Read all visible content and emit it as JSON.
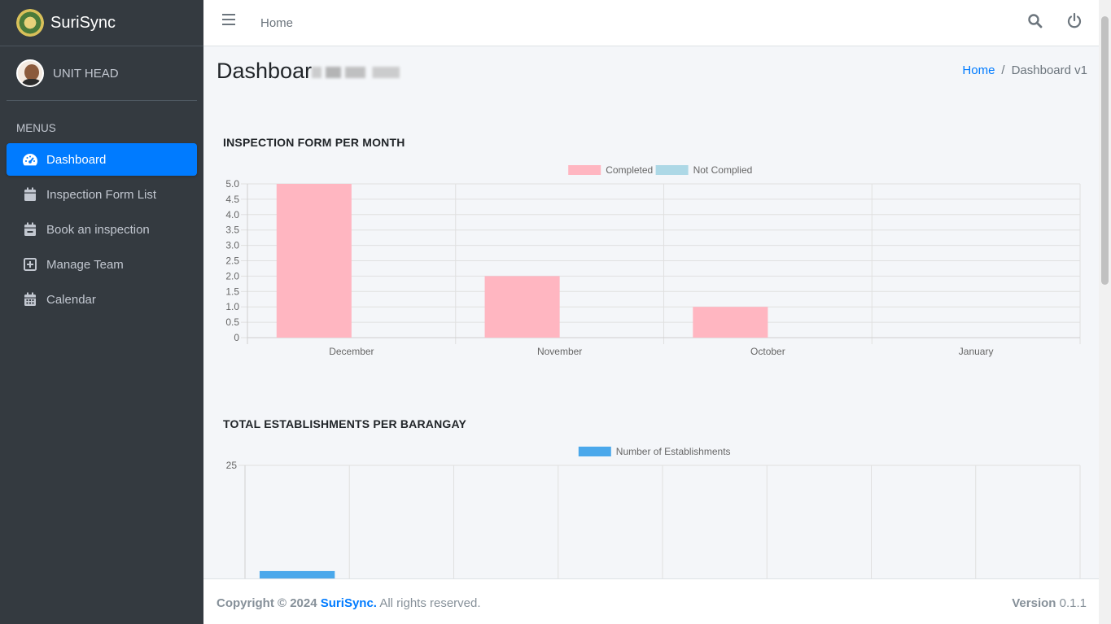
{
  "brand": {
    "name_bold": "Suri",
    "name_light": "Sync"
  },
  "user": {
    "role": "UNIT HEAD"
  },
  "sidebar": {
    "header": "MENUS",
    "items": [
      {
        "label": "Dashboard",
        "icon": "tachometer-icon",
        "active": true
      },
      {
        "label": "Inspection Form List",
        "icon": "calendar-icon"
      },
      {
        "label": "Book an inspection",
        "icon": "calendar-minus-icon"
      },
      {
        "label": "Manage Team",
        "icon": "plus-square-icon"
      },
      {
        "label": "Calendar",
        "icon": "calendar-grid-icon"
      }
    ]
  },
  "topbar": {
    "home_label": "Home"
  },
  "page": {
    "title": "Dashboar"
  },
  "breadcrumb": {
    "home": "Home",
    "separator": "/",
    "current": "Dashboard v1"
  },
  "colors": {
    "accent": "#007bff",
    "sidebar_bg": "#343a40",
    "completed": "#ffb6c1",
    "not_complied": "#add8e6",
    "establishments": "#4aa8eb"
  },
  "charts_titles": {
    "inspection": "INSPECTION FORM PER MONTH",
    "establishments": "TOTAL ESTABLISHMENTS PER BARANGAY"
  },
  "chart_data": [
    {
      "type": "bar",
      "title": "INSPECTION FORM PER MONTH",
      "categories": [
        "December",
        "November",
        "October",
        "January"
      ],
      "series": [
        {
          "name": "Completed",
          "values": [
            5,
            2,
            1,
            0
          ],
          "color": "#ffb6c1"
        },
        {
          "name": "Not Complied",
          "values": [
            0,
            0,
            0,
            0
          ],
          "color": "#add8e6"
        }
      ],
      "ylim": [
        0,
        5
      ],
      "yticks": [
        "5.0",
        "4.5",
        "4.0",
        "3.5",
        "3.0",
        "2.5",
        "2.0",
        "1.5",
        "1.0",
        "0.5",
        "0"
      ],
      "legend": "top-center",
      "grid": true
    },
    {
      "type": "bar",
      "title": "TOTAL ESTABLISHMENTS PER BARANGAY",
      "categories": [
        "",
        "",
        "",
        "",
        "",
        "",
        "",
        ""
      ],
      "series": [
        {
          "name": "Number of Establishments",
          "values": [
            11,
            null,
            null,
            null,
            null,
            null,
            null,
            null
          ],
          "color": "#4aa8eb"
        }
      ],
      "ylim": [
        0,
        25
      ],
      "yticks": [
        "25"
      ],
      "legend": "top-center",
      "grid": true
    }
  ],
  "footer": {
    "copyright": "Copyright © 2024",
    "brand": "SuriSync.",
    "rights": "All rights reserved.",
    "version_label": "Version",
    "version": "0.1.1"
  }
}
